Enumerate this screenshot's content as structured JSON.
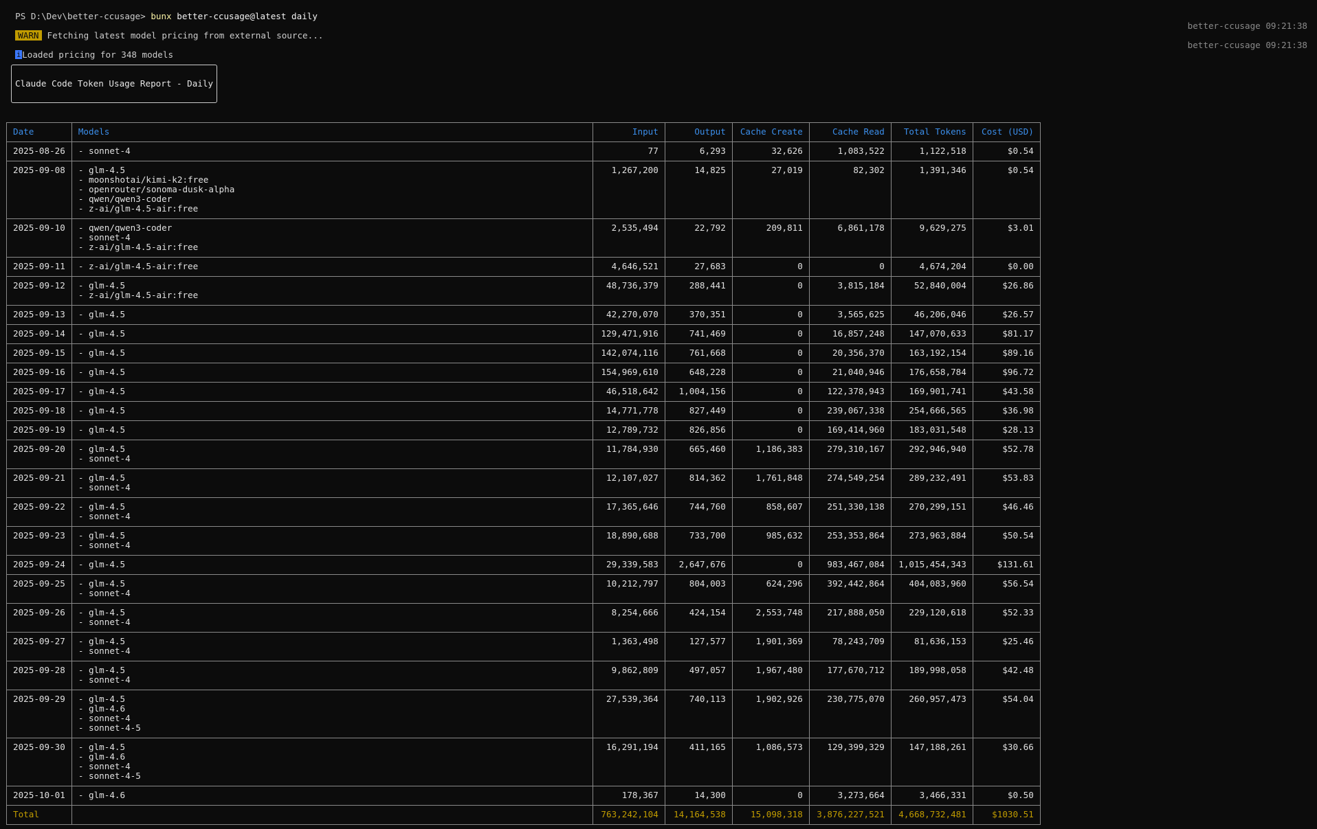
{
  "terminal": {
    "prompt": "PS D:\\Dev\\better-ccusage> ",
    "command_bin": "bunx",
    "command_args": " better-ccusage@latest daily",
    "logs": [
      {
        "badge": "WARN",
        "message": "Fetching latest model pricing from external source...",
        "source": "better-ccusage 09:21:38"
      },
      {
        "badge": "i",
        "message": "Loaded pricing for 348 models",
        "source": "better-ccusage 09:21:38"
      }
    ]
  },
  "report": {
    "title": "Claude Code Token Usage Report - Daily",
    "columns": [
      "Date",
      "Models",
      "Input",
      "Output",
      "Cache Create",
      "Cache Read",
      "Total Tokens",
      "Cost (USD)"
    ],
    "rows": [
      {
        "date": "2025-08-26",
        "models": [
          "- sonnet-4"
        ],
        "input": "77",
        "output": "6,293",
        "cache_create": "32,626",
        "cache_read": "1,083,522",
        "total": "1,122,518",
        "cost": "$0.54"
      },
      {
        "date": "2025-09-08",
        "models": [
          "- glm-4.5",
          "- moonshotai/kimi-k2:free",
          "- openrouter/sonoma-dusk-alpha",
          "- qwen/qwen3-coder",
          "- z-ai/glm-4.5-air:free"
        ],
        "input": "1,267,200",
        "output": "14,825",
        "cache_create": "27,019",
        "cache_read": "82,302",
        "total": "1,391,346",
        "cost": "$0.54"
      },
      {
        "date": "2025-09-10",
        "models": [
          "- qwen/qwen3-coder",
          "- sonnet-4",
          "- z-ai/glm-4.5-air:free"
        ],
        "input": "2,535,494",
        "output": "22,792",
        "cache_create": "209,811",
        "cache_read": "6,861,178",
        "total": "9,629,275",
        "cost": "$3.01"
      },
      {
        "date": "2025-09-11",
        "models": [
          "- z-ai/glm-4.5-air:free"
        ],
        "input": "4,646,521",
        "output": "27,683",
        "cache_create": "0",
        "cache_read": "0",
        "total": "4,674,204",
        "cost": "$0.00"
      },
      {
        "date": "2025-09-12",
        "models": [
          "- glm-4.5",
          "- z-ai/glm-4.5-air:free"
        ],
        "input": "48,736,379",
        "output": "288,441",
        "cache_create": "0",
        "cache_read": "3,815,184",
        "total": "52,840,004",
        "cost": "$26.86"
      },
      {
        "date": "2025-09-13",
        "models": [
          "- glm-4.5"
        ],
        "input": "42,270,070",
        "output": "370,351",
        "cache_create": "0",
        "cache_read": "3,565,625",
        "total": "46,206,046",
        "cost": "$26.57"
      },
      {
        "date": "2025-09-14",
        "models": [
          "- glm-4.5"
        ],
        "input": "129,471,916",
        "output": "741,469",
        "cache_create": "0",
        "cache_read": "16,857,248",
        "total": "147,070,633",
        "cost": "$81.17"
      },
      {
        "date": "2025-09-15",
        "models": [
          "- glm-4.5"
        ],
        "input": "142,074,116",
        "output": "761,668",
        "cache_create": "0",
        "cache_read": "20,356,370",
        "total": "163,192,154",
        "cost": "$89.16"
      },
      {
        "date": "2025-09-16",
        "models": [
          "- glm-4.5"
        ],
        "input": "154,969,610",
        "output": "648,228",
        "cache_create": "0",
        "cache_read": "21,040,946",
        "total": "176,658,784",
        "cost": "$96.72"
      },
      {
        "date": "2025-09-17",
        "models": [
          "- glm-4.5"
        ],
        "input": "46,518,642",
        "output": "1,004,156",
        "cache_create": "0",
        "cache_read": "122,378,943",
        "total": "169,901,741",
        "cost": "$43.58"
      },
      {
        "date": "2025-09-18",
        "models": [
          "- glm-4.5"
        ],
        "input": "14,771,778",
        "output": "827,449",
        "cache_create": "0",
        "cache_read": "239,067,338",
        "total": "254,666,565",
        "cost": "$36.98"
      },
      {
        "date": "2025-09-19",
        "models": [
          "- glm-4.5"
        ],
        "input": "12,789,732",
        "output": "826,856",
        "cache_create": "0",
        "cache_read": "169,414,960",
        "total": "183,031,548",
        "cost": "$28.13"
      },
      {
        "date": "2025-09-20",
        "models": [
          "- glm-4.5",
          "- sonnet-4"
        ],
        "input": "11,784,930",
        "output": "665,460",
        "cache_create": "1,186,383",
        "cache_read": "279,310,167",
        "total": "292,946,940",
        "cost": "$52.78"
      },
      {
        "date": "2025-09-21",
        "models": [
          "- glm-4.5",
          "- sonnet-4"
        ],
        "input": "12,107,027",
        "output": "814,362",
        "cache_create": "1,761,848",
        "cache_read": "274,549,254",
        "total": "289,232,491",
        "cost": "$53.83"
      },
      {
        "date": "2025-09-22",
        "models": [
          "- glm-4.5",
          "- sonnet-4"
        ],
        "input": "17,365,646",
        "output": "744,760",
        "cache_create": "858,607",
        "cache_read": "251,330,138",
        "total": "270,299,151",
        "cost": "$46.46"
      },
      {
        "date": "2025-09-23",
        "models": [
          "- glm-4.5",
          "- sonnet-4"
        ],
        "input": "18,890,688",
        "output": "733,700",
        "cache_create": "985,632",
        "cache_read": "253,353,864",
        "total": "273,963,884",
        "cost": "$50.54"
      },
      {
        "date": "2025-09-24",
        "models": [
          "- glm-4.5"
        ],
        "input": "29,339,583",
        "output": "2,647,676",
        "cache_create": "0",
        "cache_read": "983,467,084",
        "total": "1,015,454,343",
        "cost": "$131.61"
      },
      {
        "date": "2025-09-25",
        "models": [
          "- glm-4.5",
          "- sonnet-4"
        ],
        "input": "10,212,797",
        "output": "804,003",
        "cache_create": "624,296",
        "cache_read": "392,442,864",
        "total": "404,083,960",
        "cost": "$56.54"
      },
      {
        "date": "2025-09-26",
        "models": [
          "- glm-4.5",
          "- sonnet-4"
        ],
        "input": "8,254,666",
        "output": "424,154",
        "cache_create": "2,553,748",
        "cache_read": "217,888,050",
        "total": "229,120,618",
        "cost": "$52.33"
      },
      {
        "date": "2025-09-27",
        "models": [
          "- glm-4.5",
          "- sonnet-4"
        ],
        "input": "1,363,498",
        "output": "127,577",
        "cache_create": "1,901,369",
        "cache_read": "78,243,709",
        "total": "81,636,153",
        "cost": "$25.46"
      },
      {
        "date": "2025-09-28",
        "models": [
          "- glm-4.5",
          "- sonnet-4"
        ],
        "input": "9,862,809",
        "output": "497,057",
        "cache_create": "1,967,480",
        "cache_read": "177,670,712",
        "total": "189,998,058",
        "cost": "$42.48"
      },
      {
        "date": "2025-09-29",
        "models": [
          "- glm-4.5",
          "- glm-4.6",
          "- sonnet-4",
          "- sonnet-4-5"
        ],
        "input": "27,539,364",
        "output": "740,113",
        "cache_create": "1,902,926",
        "cache_read": "230,775,070",
        "total": "260,957,473",
        "cost": "$54.04"
      },
      {
        "date": "2025-09-30",
        "models": [
          "- glm-4.5",
          "- glm-4.6",
          "- sonnet-4",
          "- sonnet-4-5"
        ],
        "input": "16,291,194",
        "output": "411,165",
        "cache_create": "1,086,573",
        "cache_read": "129,399,329",
        "total": "147,188,261",
        "cost": "$30.66"
      },
      {
        "date": "2025-10-01",
        "models": [
          "- glm-4.6"
        ],
        "input": "178,367",
        "output": "14,300",
        "cache_create": "0",
        "cache_read": "3,273,664",
        "total": "3,466,331",
        "cost": "$0.50"
      }
    ],
    "total": {
      "label": "Total",
      "models": "",
      "input": "763,242,104",
      "output": "14,164,538",
      "cache_create": "15,098,318",
      "cache_read": "3,876,227,521",
      "total": "4,668,732,481",
      "cost": "$1030.51"
    }
  },
  "colors": {
    "background": "#0c0c0c",
    "foreground": "#cccccc",
    "header": "#3b8eea",
    "total": "#c19c00",
    "warn_badge": "#c19c00",
    "info_badge": "#3b78ff"
  }
}
